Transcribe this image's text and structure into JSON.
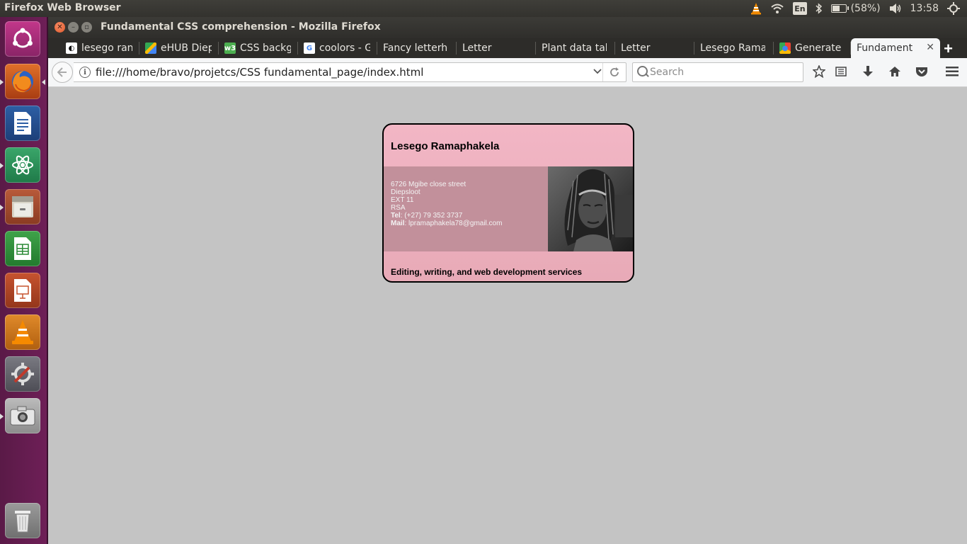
{
  "system_panel": {
    "app_title": "Firefox Web Browser",
    "keyboard_layout": "En",
    "battery_text": "(58%)",
    "battery_level": 0.58,
    "clock": "13:58"
  },
  "launcher": {
    "items": [
      {
        "name": "ubuntu-dash-icon"
      },
      {
        "name": "firefox-icon"
      },
      {
        "name": "libreoffice-writer-icon"
      },
      {
        "name": "atom-editor-icon"
      },
      {
        "name": "files-icon"
      },
      {
        "name": "libreoffice-calc-icon"
      },
      {
        "name": "libreoffice-impress-icon"
      },
      {
        "name": "vlc-icon"
      },
      {
        "name": "system-settings-icon"
      },
      {
        "name": "screenshot-camera-icon"
      },
      {
        "name": "trash-icon"
      }
    ]
  },
  "window": {
    "title": "Fundamental CSS comprehension - Mozilla Firefox"
  },
  "tabs": [
    {
      "label": "lesego ran",
      "favicon": "document-icon"
    },
    {
      "label": "eHUB Diep",
      "favicon": "maps-icon"
    },
    {
      "label": "CSS backg",
      "favicon": "w3schools-icon"
    },
    {
      "label": "coolors - G",
      "favicon": "google-icon"
    },
    {
      "label": "Fancy letterhe",
      "favicon": ""
    },
    {
      "label": "Letter",
      "favicon": ""
    },
    {
      "label": "Plant data tab",
      "favicon": ""
    },
    {
      "label": "Letter",
      "favicon": ""
    },
    {
      "label": "Lesego Ramap",
      "favicon": ""
    },
    {
      "label": "Generate",
      "favicon": "chrome-icon"
    },
    {
      "label": "Fundament",
      "favicon": "",
      "active": true
    }
  ],
  "navbar": {
    "url": "file:///home/bravo/projetcs/CSS fundamental_page/index.html",
    "search_placeholder": "Search"
  },
  "card": {
    "name": "Lesego Ramaphakela",
    "address": [
      "6726 Mgibe close street",
      "Diepsloot",
      "EXT 11",
      "RSA"
    ],
    "tel_label": "Tel",
    "tel_value": ": (+27) 79 352 3737",
    "mail_label": "Mail",
    "mail_value": ": lpramaphakela78@gmail.com",
    "footer": "Editing, writing, and web development services"
  }
}
